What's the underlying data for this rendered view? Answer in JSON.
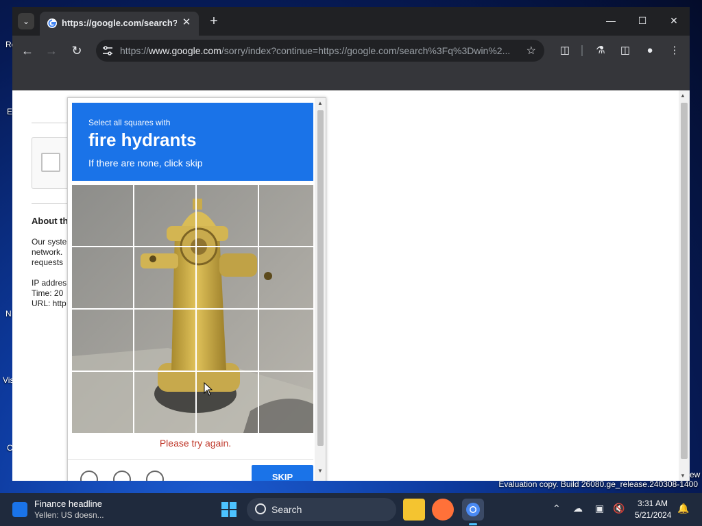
{
  "desktop": {
    "icon_labels": [
      "Re",
      "E",
      "N",
      "Vis",
      "C"
    ],
    "watermark": "Evaluation copy. Build 26080.ge_release.240308-1400",
    "corner_partial": "ew"
  },
  "browser": {
    "tab_title": "https://google.com/search?q=",
    "url_prefix": "https://",
    "url_host": "www.google.com",
    "url_rest": "/sorry/index?continue=https://google.com/search%3Fq%3Dwin%2..."
  },
  "page": {
    "about_title": "About th",
    "about_lines": [
      "Our syste",
      "network.",
      "requests"
    ],
    "info_lines": [
      "IP addres",
      "Time: 20",
      "URL: http"
    ]
  },
  "captcha": {
    "instruction_line1": "Select all squares with",
    "instruction_target": "fire hydrants",
    "instruction_line3": "If there are none, click skip",
    "error_message": "Please try again.",
    "skip_label": "SKIP"
  },
  "taskbar": {
    "widget_title": "Finance headline",
    "widget_subtitle": "Yellen: US doesn...",
    "search_label": "Search",
    "time": "3:31 AM",
    "date": "5/21/2024"
  },
  "colors": {
    "captcha_header": "#1a73e8",
    "error_text": "#c0392b",
    "hydrant_yellow": "#d9b84a"
  }
}
